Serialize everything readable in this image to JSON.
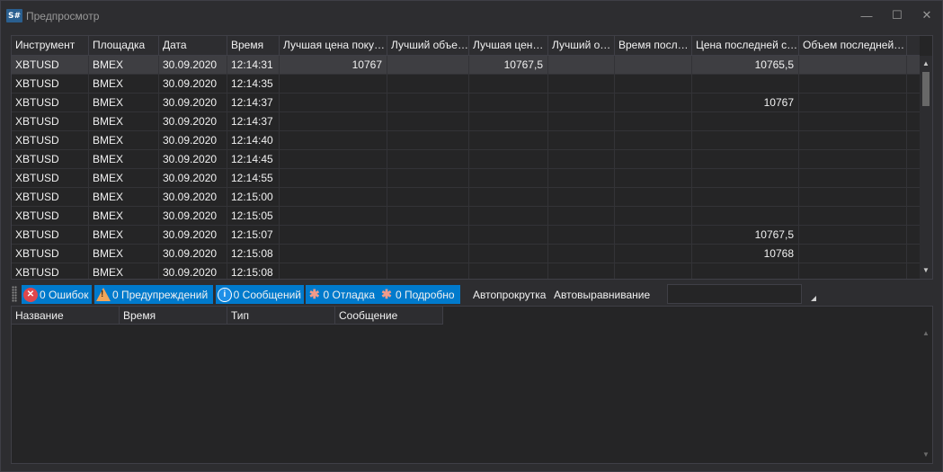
{
  "window": {
    "icon_text": "S#",
    "title": "Предпросмотр",
    "min_glyph": "—",
    "max_glyph": "☐",
    "close_glyph": "✕"
  },
  "grid": {
    "columns": [
      "Инструмент",
      "Площадка",
      "Дата",
      "Время",
      "Лучшая цена поку…",
      "Лучший объе…",
      "Лучшая цен…",
      "Лучший о…",
      "Время посл…",
      "Цена последней с…",
      "Объем последней…"
    ],
    "rows": [
      [
        "XBTUSD",
        "BMEX",
        "30.09.2020",
        "12:14:31",
        "10767",
        "",
        "10767,5",
        "",
        "",
        "10765,5",
        ""
      ],
      [
        "XBTUSD",
        "BMEX",
        "30.09.2020",
        "12:14:35",
        "",
        "",
        "",
        "",
        "",
        "",
        ""
      ],
      [
        "XBTUSD",
        "BMEX",
        "30.09.2020",
        "12:14:37",
        "",
        "",
        "",
        "",
        "",
        "10767",
        ""
      ],
      [
        "XBTUSD",
        "BMEX",
        "30.09.2020",
        "12:14:37",
        "",
        "",
        "",
        "",
        "",
        "",
        ""
      ],
      [
        "XBTUSD",
        "BMEX",
        "30.09.2020",
        "12:14:40",
        "",
        "",
        "",
        "",
        "",
        "",
        ""
      ],
      [
        "XBTUSD",
        "BMEX",
        "30.09.2020",
        "12:14:45",
        "",
        "",
        "",
        "",
        "",
        "",
        ""
      ],
      [
        "XBTUSD",
        "BMEX",
        "30.09.2020",
        "12:14:55",
        "",
        "",
        "",
        "",
        "",
        "",
        ""
      ],
      [
        "XBTUSD",
        "BMEX",
        "30.09.2020",
        "12:15:00",
        "",
        "",
        "",
        "",
        "",
        "",
        ""
      ],
      [
        "XBTUSD",
        "BMEX",
        "30.09.2020",
        "12:15:05",
        "",
        "",
        "",
        "",
        "",
        "",
        ""
      ],
      [
        "XBTUSD",
        "BMEX",
        "30.09.2020",
        "12:15:07",
        "",
        "",
        "",
        "",
        "",
        "10767,5",
        ""
      ],
      [
        "XBTUSD",
        "BMEX",
        "30.09.2020",
        "12:15:08",
        "",
        "",
        "",
        "",
        "",
        "10768",
        ""
      ],
      [
        "XBTUSD",
        "BMEX",
        "30.09.2020",
        "12:15:08",
        "",
        "",
        "",
        "",
        "",
        "",
        ""
      ]
    ],
    "selected_row": 0
  },
  "toolbar": {
    "errors_label": "0 Ошибок",
    "warnings_label": "0 Предупреждений",
    "messages_label": "0 Сообщений",
    "debug_label": "0 Отладка",
    "verbose_label": "0 Подробно",
    "autoscroll_label": "Автопрокрутка",
    "autoalign_label": "Автовыравнивание",
    "search_value": ""
  },
  "log": {
    "columns": [
      "Название",
      "Время",
      "Тип",
      "Сообщение"
    ]
  },
  "icons": {
    "error": "error-icon",
    "warning": "warning-icon",
    "info": "info-icon",
    "debug": "bug-icon",
    "verbose": "bug-icon"
  },
  "colors": {
    "accent": "#007acc",
    "background": "#2d2d30",
    "grid_background": "#252526",
    "selected_row": "#3e3e42",
    "error": "#e0474c",
    "warning": "#f2a65a",
    "info": "#1e90e8"
  }
}
